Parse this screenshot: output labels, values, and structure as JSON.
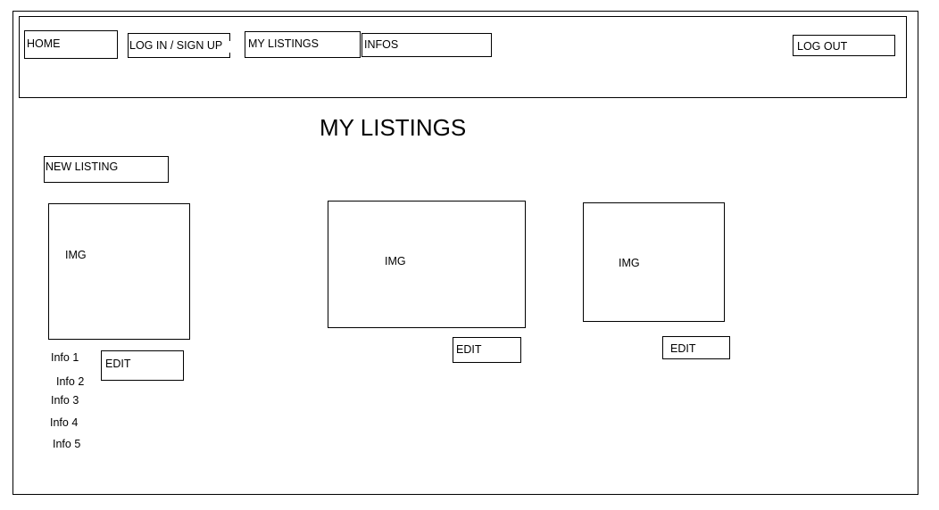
{
  "nav": {
    "home_label": "HOME",
    "login_label": "LOG IN / SIGN UP",
    "my_listings_label": "MY LISTINGS",
    "infos_label": "INFOS",
    "logout_label": "LOG OUT"
  },
  "main": {
    "page_title": "MY LISTINGS",
    "new_listing_label": "NEW LISTING",
    "listings": [
      {
        "image_label": "IMG",
        "edit_label": "EDIT",
        "info": [
          "Info 1",
          "Info 2",
          "Info 3",
          "Info 4",
          "Info 5"
        ]
      },
      {
        "image_label": "IMG",
        "edit_label": "EDIT"
      },
      {
        "image_label": "IMG",
        "edit_label": "EDIT"
      }
    ]
  }
}
